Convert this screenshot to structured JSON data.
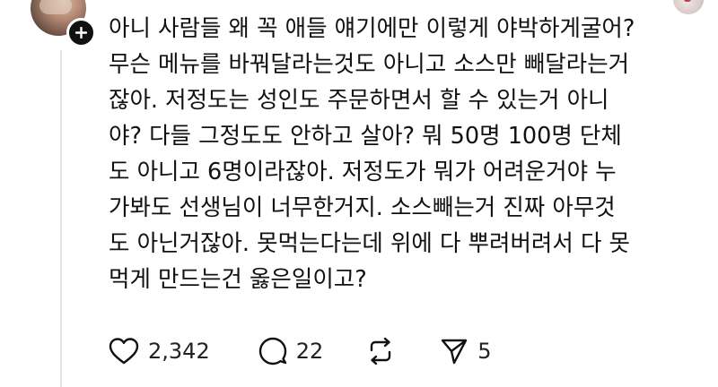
{
  "post": {
    "lines": [
      "아니 사람들 왜 꼭 애들 얘기에만 이렇게 야박하게굴어?",
      "무슨 메뉴를 바꿔달라는것도 아니고 소스만 빼달라는거",
      "잖아. 저정도는 성인도 주문하면서 할 수 있는거 아니",
      "야? 다들 그정도도 안하고 살아? 뭐 50명 100명 단체",
      "도 아니고 6명이라잖아. 저정도가 뭐가 어려운거야 누",
      "가봐도 선생님이 너무한거지. 소스빼는거 진짜 아무것",
      "도 아닌거잖아. 못먹는다는데 위에 다 뿌려버려서 다 못",
      "먹게 만드는건 옳은일이고?"
    ]
  },
  "actions": {
    "likes": "2,342",
    "comments": "22",
    "shares": "5"
  },
  "icons": {
    "like": "heart-icon",
    "comment": "comment-bubble-icon",
    "repost": "repost-icon",
    "share": "send-icon",
    "follow": "plus-icon"
  }
}
